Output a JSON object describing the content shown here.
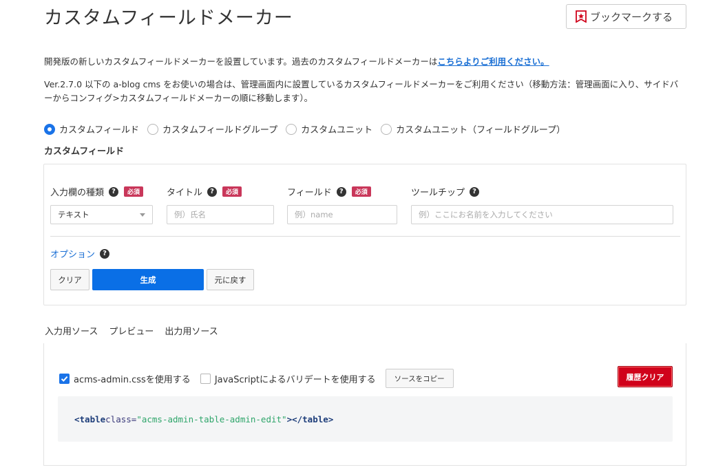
{
  "header": {
    "title": "カスタムフィールドメーカー",
    "bookmark_label": "ブックマークする"
  },
  "intro": {
    "text": "開発版の新しいカスタムフィールドメーカーを設置しています。過去のカスタムフィールドメーカーは",
    "link": "こちらよりご利用ください。"
  },
  "note": "Ver.2.7.0 以下の a-blog cms をお使いの場合は、管理画面内に設置しているカスタムフィールドメーカーをご利用ください（移動方法：管理画面に入り、サイドバーからコンフィグ>カスタムフィールドメーカーの順に移動します）。",
  "modes": {
    "items": [
      {
        "label": "カスタムフィールド",
        "checked": true
      },
      {
        "label": "カスタムフィールドグループ",
        "checked": false
      },
      {
        "label": "カスタムユニット",
        "checked": false
      },
      {
        "label": "カスタムユニット（フィールドグループ）",
        "checked": false
      }
    ]
  },
  "section_title": "カスタムフィールド",
  "form": {
    "type_label": "入力欄の種類",
    "title_label": "タイトル",
    "field_label": "フィールド",
    "tooltip_label": "ツールチップ",
    "required": "必須",
    "help": "?",
    "type_value": "テキスト",
    "title_placeholder": "例）氏名",
    "field_placeholder": "例）name",
    "tooltip_placeholder": "例）ここにお名前を入力してください",
    "option_label": "オプション",
    "clear_label": "クリア",
    "generate_label": "生成",
    "undo_label": "元に戻す"
  },
  "tabs": {
    "items": [
      "入力用ソース",
      "プレビュー",
      "出力用ソース"
    ],
    "active": 0
  },
  "source": {
    "use_admin_css": "acms-admin.cssを使用する",
    "use_js_validate": "JavaScriptによるバリデートを使用する",
    "copy_label": "ソースをコピー",
    "clear_history_label": "履歴クリア",
    "code": {
      "open_tag": "<table",
      "attr_name": " class=",
      "attr_value": "\"acms-admin-table-admin-edit\"",
      "close_tag": "></table>"
    }
  },
  "colors": {
    "accent": "#1a73e8",
    "required": "#c9375a",
    "danger": "#d0021b",
    "link": "#1a6fd4"
  }
}
